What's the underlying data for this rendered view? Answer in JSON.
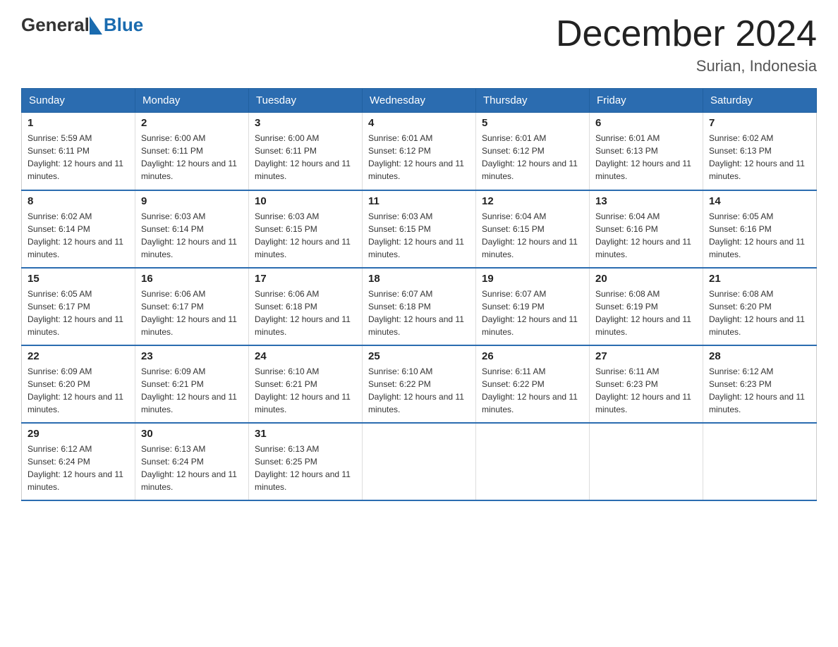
{
  "header": {
    "logo_general": "General",
    "logo_blue": "Blue",
    "title": "December 2024",
    "subtitle": "Surian, Indonesia"
  },
  "calendar": {
    "headers": [
      "Sunday",
      "Monday",
      "Tuesday",
      "Wednesday",
      "Thursday",
      "Friday",
      "Saturday"
    ],
    "weeks": [
      [
        {
          "day": "1",
          "sunrise": "5:59 AM",
          "sunset": "6:11 PM",
          "daylight": "12 hours and 11 minutes."
        },
        {
          "day": "2",
          "sunrise": "6:00 AM",
          "sunset": "6:11 PM",
          "daylight": "12 hours and 11 minutes."
        },
        {
          "day": "3",
          "sunrise": "6:00 AM",
          "sunset": "6:11 PM",
          "daylight": "12 hours and 11 minutes."
        },
        {
          "day": "4",
          "sunrise": "6:01 AM",
          "sunset": "6:12 PM",
          "daylight": "12 hours and 11 minutes."
        },
        {
          "day": "5",
          "sunrise": "6:01 AM",
          "sunset": "6:12 PM",
          "daylight": "12 hours and 11 minutes."
        },
        {
          "day": "6",
          "sunrise": "6:01 AM",
          "sunset": "6:13 PM",
          "daylight": "12 hours and 11 minutes."
        },
        {
          "day": "7",
          "sunrise": "6:02 AM",
          "sunset": "6:13 PM",
          "daylight": "12 hours and 11 minutes."
        }
      ],
      [
        {
          "day": "8",
          "sunrise": "6:02 AM",
          "sunset": "6:14 PM",
          "daylight": "12 hours and 11 minutes."
        },
        {
          "day": "9",
          "sunrise": "6:03 AM",
          "sunset": "6:14 PM",
          "daylight": "12 hours and 11 minutes."
        },
        {
          "day": "10",
          "sunrise": "6:03 AM",
          "sunset": "6:15 PM",
          "daylight": "12 hours and 11 minutes."
        },
        {
          "day": "11",
          "sunrise": "6:03 AM",
          "sunset": "6:15 PM",
          "daylight": "12 hours and 11 minutes."
        },
        {
          "day": "12",
          "sunrise": "6:04 AM",
          "sunset": "6:15 PM",
          "daylight": "12 hours and 11 minutes."
        },
        {
          "day": "13",
          "sunrise": "6:04 AM",
          "sunset": "6:16 PM",
          "daylight": "12 hours and 11 minutes."
        },
        {
          "day": "14",
          "sunrise": "6:05 AM",
          "sunset": "6:16 PM",
          "daylight": "12 hours and 11 minutes."
        }
      ],
      [
        {
          "day": "15",
          "sunrise": "6:05 AM",
          "sunset": "6:17 PM",
          "daylight": "12 hours and 11 minutes."
        },
        {
          "day": "16",
          "sunrise": "6:06 AM",
          "sunset": "6:17 PM",
          "daylight": "12 hours and 11 minutes."
        },
        {
          "day": "17",
          "sunrise": "6:06 AM",
          "sunset": "6:18 PM",
          "daylight": "12 hours and 11 minutes."
        },
        {
          "day": "18",
          "sunrise": "6:07 AM",
          "sunset": "6:18 PM",
          "daylight": "12 hours and 11 minutes."
        },
        {
          "day": "19",
          "sunrise": "6:07 AM",
          "sunset": "6:19 PM",
          "daylight": "12 hours and 11 minutes."
        },
        {
          "day": "20",
          "sunrise": "6:08 AM",
          "sunset": "6:19 PM",
          "daylight": "12 hours and 11 minutes."
        },
        {
          "day": "21",
          "sunrise": "6:08 AM",
          "sunset": "6:20 PM",
          "daylight": "12 hours and 11 minutes."
        }
      ],
      [
        {
          "day": "22",
          "sunrise": "6:09 AM",
          "sunset": "6:20 PM",
          "daylight": "12 hours and 11 minutes."
        },
        {
          "day": "23",
          "sunrise": "6:09 AM",
          "sunset": "6:21 PM",
          "daylight": "12 hours and 11 minutes."
        },
        {
          "day": "24",
          "sunrise": "6:10 AM",
          "sunset": "6:21 PM",
          "daylight": "12 hours and 11 minutes."
        },
        {
          "day": "25",
          "sunrise": "6:10 AM",
          "sunset": "6:22 PM",
          "daylight": "12 hours and 11 minutes."
        },
        {
          "day": "26",
          "sunrise": "6:11 AM",
          "sunset": "6:22 PM",
          "daylight": "12 hours and 11 minutes."
        },
        {
          "day": "27",
          "sunrise": "6:11 AM",
          "sunset": "6:23 PM",
          "daylight": "12 hours and 11 minutes."
        },
        {
          "day": "28",
          "sunrise": "6:12 AM",
          "sunset": "6:23 PM",
          "daylight": "12 hours and 11 minutes."
        }
      ],
      [
        {
          "day": "29",
          "sunrise": "6:12 AM",
          "sunset": "6:24 PM",
          "daylight": "12 hours and 11 minutes."
        },
        {
          "day": "30",
          "sunrise": "6:13 AM",
          "sunset": "6:24 PM",
          "daylight": "12 hours and 11 minutes."
        },
        {
          "day": "31",
          "sunrise": "6:13 AM",
          "sunset": "6:25 PM",
          "daylight": "12 hours and 11 minutes."
        },
        null,
        null,
        null,
        null
      ]
    ]
  }
}
